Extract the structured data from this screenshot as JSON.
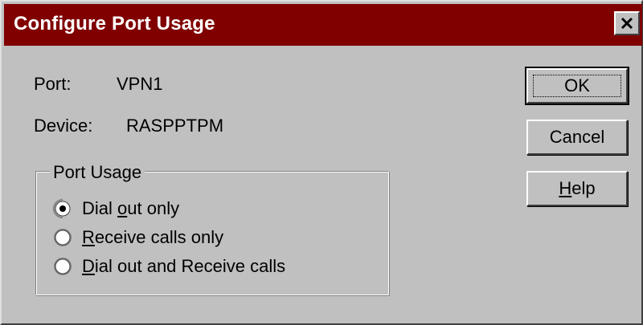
{
  "window": {
    "title": "Configure Port Usage",
    "close_label": "×"
  },
  "info": {
    "port_label": "Port:",
    "port_value": "VPN1",
    "device_label": "Device:",
    "device_value": "RASPPTPM"
  },
  "buttons": {
    "ok": "OK",
    "cancel": "Cancel",
    "help_prefix": "",
    "help_mnemonic": "H",
    "help_rest": "elp"
  },
  "port_usage": {
    "legend": "Port Usage",
    "selected": "dial_out_only",
    "options": [
      {
        "id": "dial_out_only",
        "pre": "Dial ",
        "mn": "o",
        "post": "ut only",
        "checked": true
      },
      {
        "id": "receive_only",
        "pre": "",
        "mn": "R",
        "post": "eceive calls only",
        "checked": false
      },
      {
        "id": "dial_and_receive",
        "pre": "",
        "mn": "D",
        "post": "ial out and Receive calls",
        "checked": false
      }
    ]
  },
  "colors": {
    "titlebar": "#800000",
    "face": "#c0c0c0"
  }
}
